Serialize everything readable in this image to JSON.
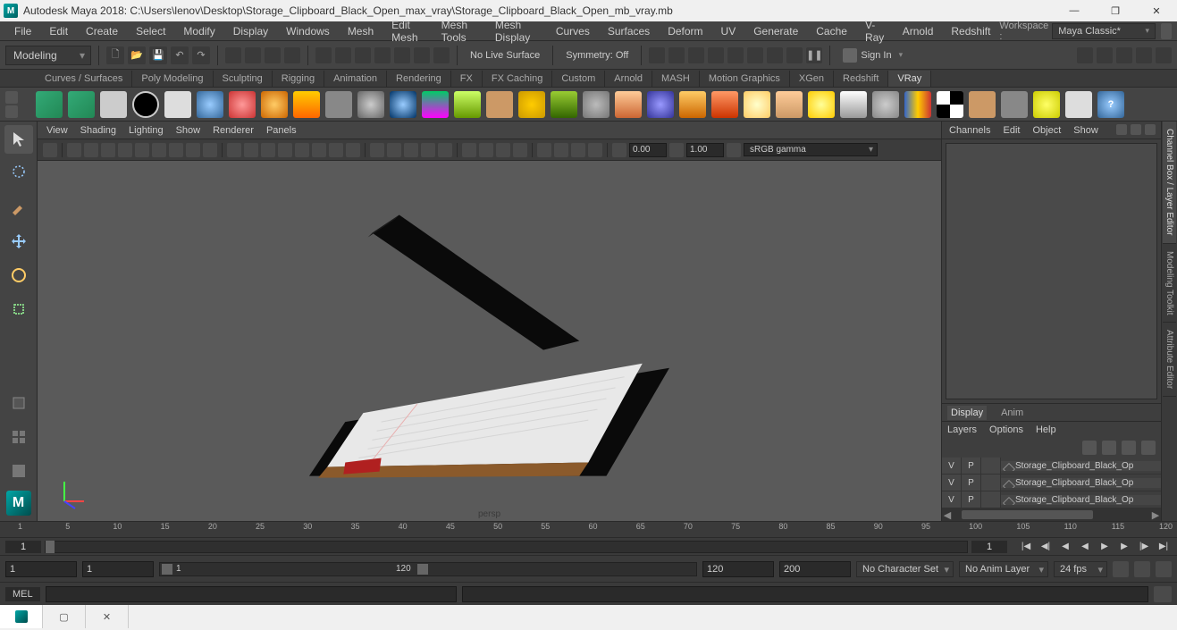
{
  "title": "Autodesk Maya 2018: C:\\Users\\lenov\\Desktop\\Storage_Clipboard_Black_Open_max_vray\\Storage_Clipboard_Black_Open_mb_vray.mb",
  "mainmenu": [
    "File",
    "Edit",
    "Create",
    "Select",
    "Modify",
    "Display",
    "Windows",
    "Mesh",
    "Edit Mesh",
    "Mesh Tools",
    "Mesh Display",
    "Curves",
    "Surfaces",
    "Deform",
    "UV",
    "Generate",
    "Cache",
    "V-Ray",
    "Arnold",
    "Redshift"
  ],
  "workspace_label": "Workspace :",
  "workspace_value": "Maya Classic*",
  "mode": "Modeling",
  "no_live_surface": "No Live Surface",
  "symmetry": "Symmetry: Off",
  "signin": "Sign In",
  "shelftabs": [
    "Curves / Surfaces",
    "Poly Modeling",
    "Sculpting",
    "Rigging",
    "Animation",
    "Rendering",
    "FX",
    "FX Caching",
    "Custom",
    "Arnold",
    "MASH",
    "Motion Graphics",
    "XGen",
    "Redshift",
    "VRay"
  ],
  "active_shelf": "VRay",
  "vpmenu": [
    "View",
    "Shading",
    "Lighting",
    "Show",
    "Renderer",
    "Panels"
  ],
  "vp_val1": "0.00",
  "vp_val2": "1.00",
  "vp_gamma": "sRGB gamma",
  "vp_camera": "persp",
  "channel_tabs": [
    "Channels",
    "Edit",
    "Object",
    "Show"
  ],
  "display_tab": "Display",
  "anim_tab": "Anim",
  "layer_menu": [
    "Layers",
    "Options",
    "Help"
  ],
  "layers": [
    {
      "v": "V",
      "p": "P",
      "name": "Storage_Clipboard_Black_Op"
    },
    {
      "v": "V",
      "p": "P",
      "name": "Storage_Clipboard_Black_Op"
    },
    {
      "v": "V",
      "p": "P",
      "name": "Storage_Clipboard_Black_Op"
    }
  ],
  "side_tabs": [
    "Channel Box / Layer Editor",
    "Modeling Toolkit",
    "Attribute Editor"
  ],
  "timeline_ticks": [
    "1",
    "5",
    "10",
    "15",
    "20",
    "25",
    "30",
    "35",
    "40",
    "45",
    "50",
    "55",
    "60",
    "65",
    "70",
    "75",
    "80",
    "85",
    "90",
    "95",
    "100",
    "105",
    "110",
    "115",
    "120"
  ],
  "time_current": "1",
  "time_end_vis": "1",
  "range_start": "1",
  "range_inner_start": "1",
  "range_inner_end": "120",
  "range_play_end": "120",
  "range_end": "200",
  "charset": "No Character Set",
  "animlayer": "No Anim Layer",
  "fps": "24 fps",
  "cmd_lang": "MEL"
}
